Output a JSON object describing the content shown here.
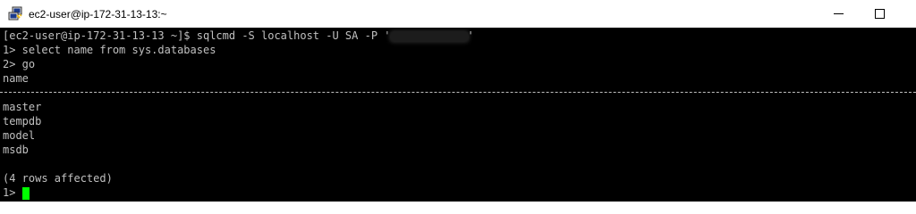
{
  "window": {
    "title": "ec2-user@ip-172-31-13-13:~",
    "app_icon": "putty-icon",
    "controls": [
      "minimize-icon",
      "maximize-icon"
    ]
  },
  "terminal": {
    "command_prompt": "[ec2-user@ip-172-31-13-13 ~]$ ",
    "command": "sqlcmd -S localhost -U SA -P '",
    "password_masked": "redacted",
    "command_tail": "'",
    "sql_lines": [
      "1> select name from sys.databases",
      "2> go"
    ],
    "column_header": "name",
    "rows": [
      "master",
      "tempdb",
      "model",
      "msdb"
    ],
    "result_summary": "(4 rows affected)",
    "current_prompt": "1> ",
    "cursor_color": "#00ff00"
  }
}
